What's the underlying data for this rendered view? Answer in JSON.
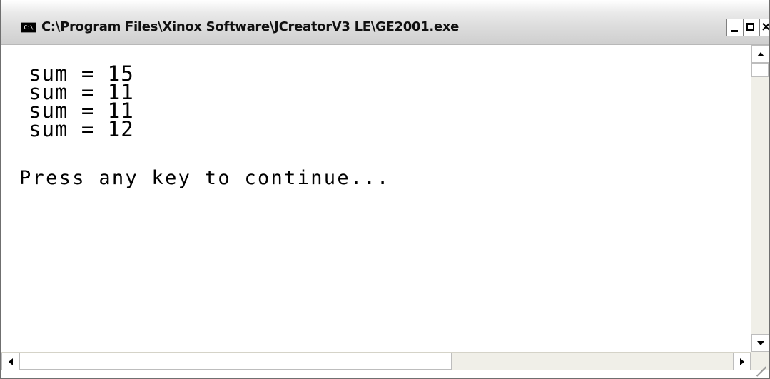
{
  "window": {
    "title": "C:\\Program Files\\Xinox Software\\JCreatorV3 LE\\GE2001.exe",
    "icon": "console-icon",
    "icon_text": "C:\\"
  },
  "console": {
    "lines": [
      "sum = 15",
      "sum = 11",
      "sum = 11",
      "sum = 12"
    ],
    "prompt": "Press any key to continue..."
  },
  "controls": {
    "minimize_icon": "minimize-icon",
    "maximize_icon": "maximize-icon",
    "close_icon": "close-icon",
    "close_glyph": "×"
  },
  "colors": {
    "background": "#ffffff",
    "text": "#000000",
    "titlebar": "#dcdcdc"
  }
}
